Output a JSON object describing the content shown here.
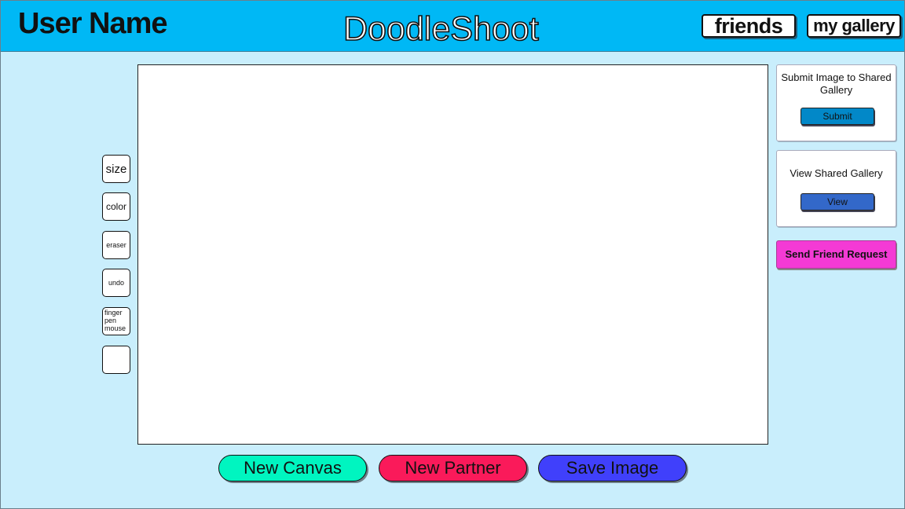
{
  "header": {
    "user_name": "User Name",
    "app_title": "DoodleShoot",
    "friends_label": "friends",
    "gallery_label": "my gallery"
  },
  "tools": [
    {
      "label": "size"
    },
    {
      "label": "color"
    },
    {
      "label": "eraser"
    },
    {
      "label": "undo"
    },
    {
      "label": "finger\npen\nmouse"
    },
    {
      "label": ""
    }
  ],
  "submit_panel": {
    "text": "Submit Image to Shared Gallery",
    "button": "Submit",
    "button_color": "#0288c8"
  },
  "view_panel": {
    "text": "View Shared Gallery",
    "button": "View",
    "button_color": "#3368c9"
  },
  "send_request": {
    "label": "Send Friend Request",
    "color": "#f43ad5"
  },
  "bottom_buttons": [
    {
      "label": "New Canvas",
      "color": "#00f5c0"
    },
    {
      "label": "New Partner",
      "color": "#fa1a5a"
    },
    {
      "label": "Save Image",
      "color": "#4040fb"
    }
  ],
  "colors": {
    "background": "#c9eefc",
    "header": "#00b8f5",
    "canvas": "#ffffff"
  }
}
